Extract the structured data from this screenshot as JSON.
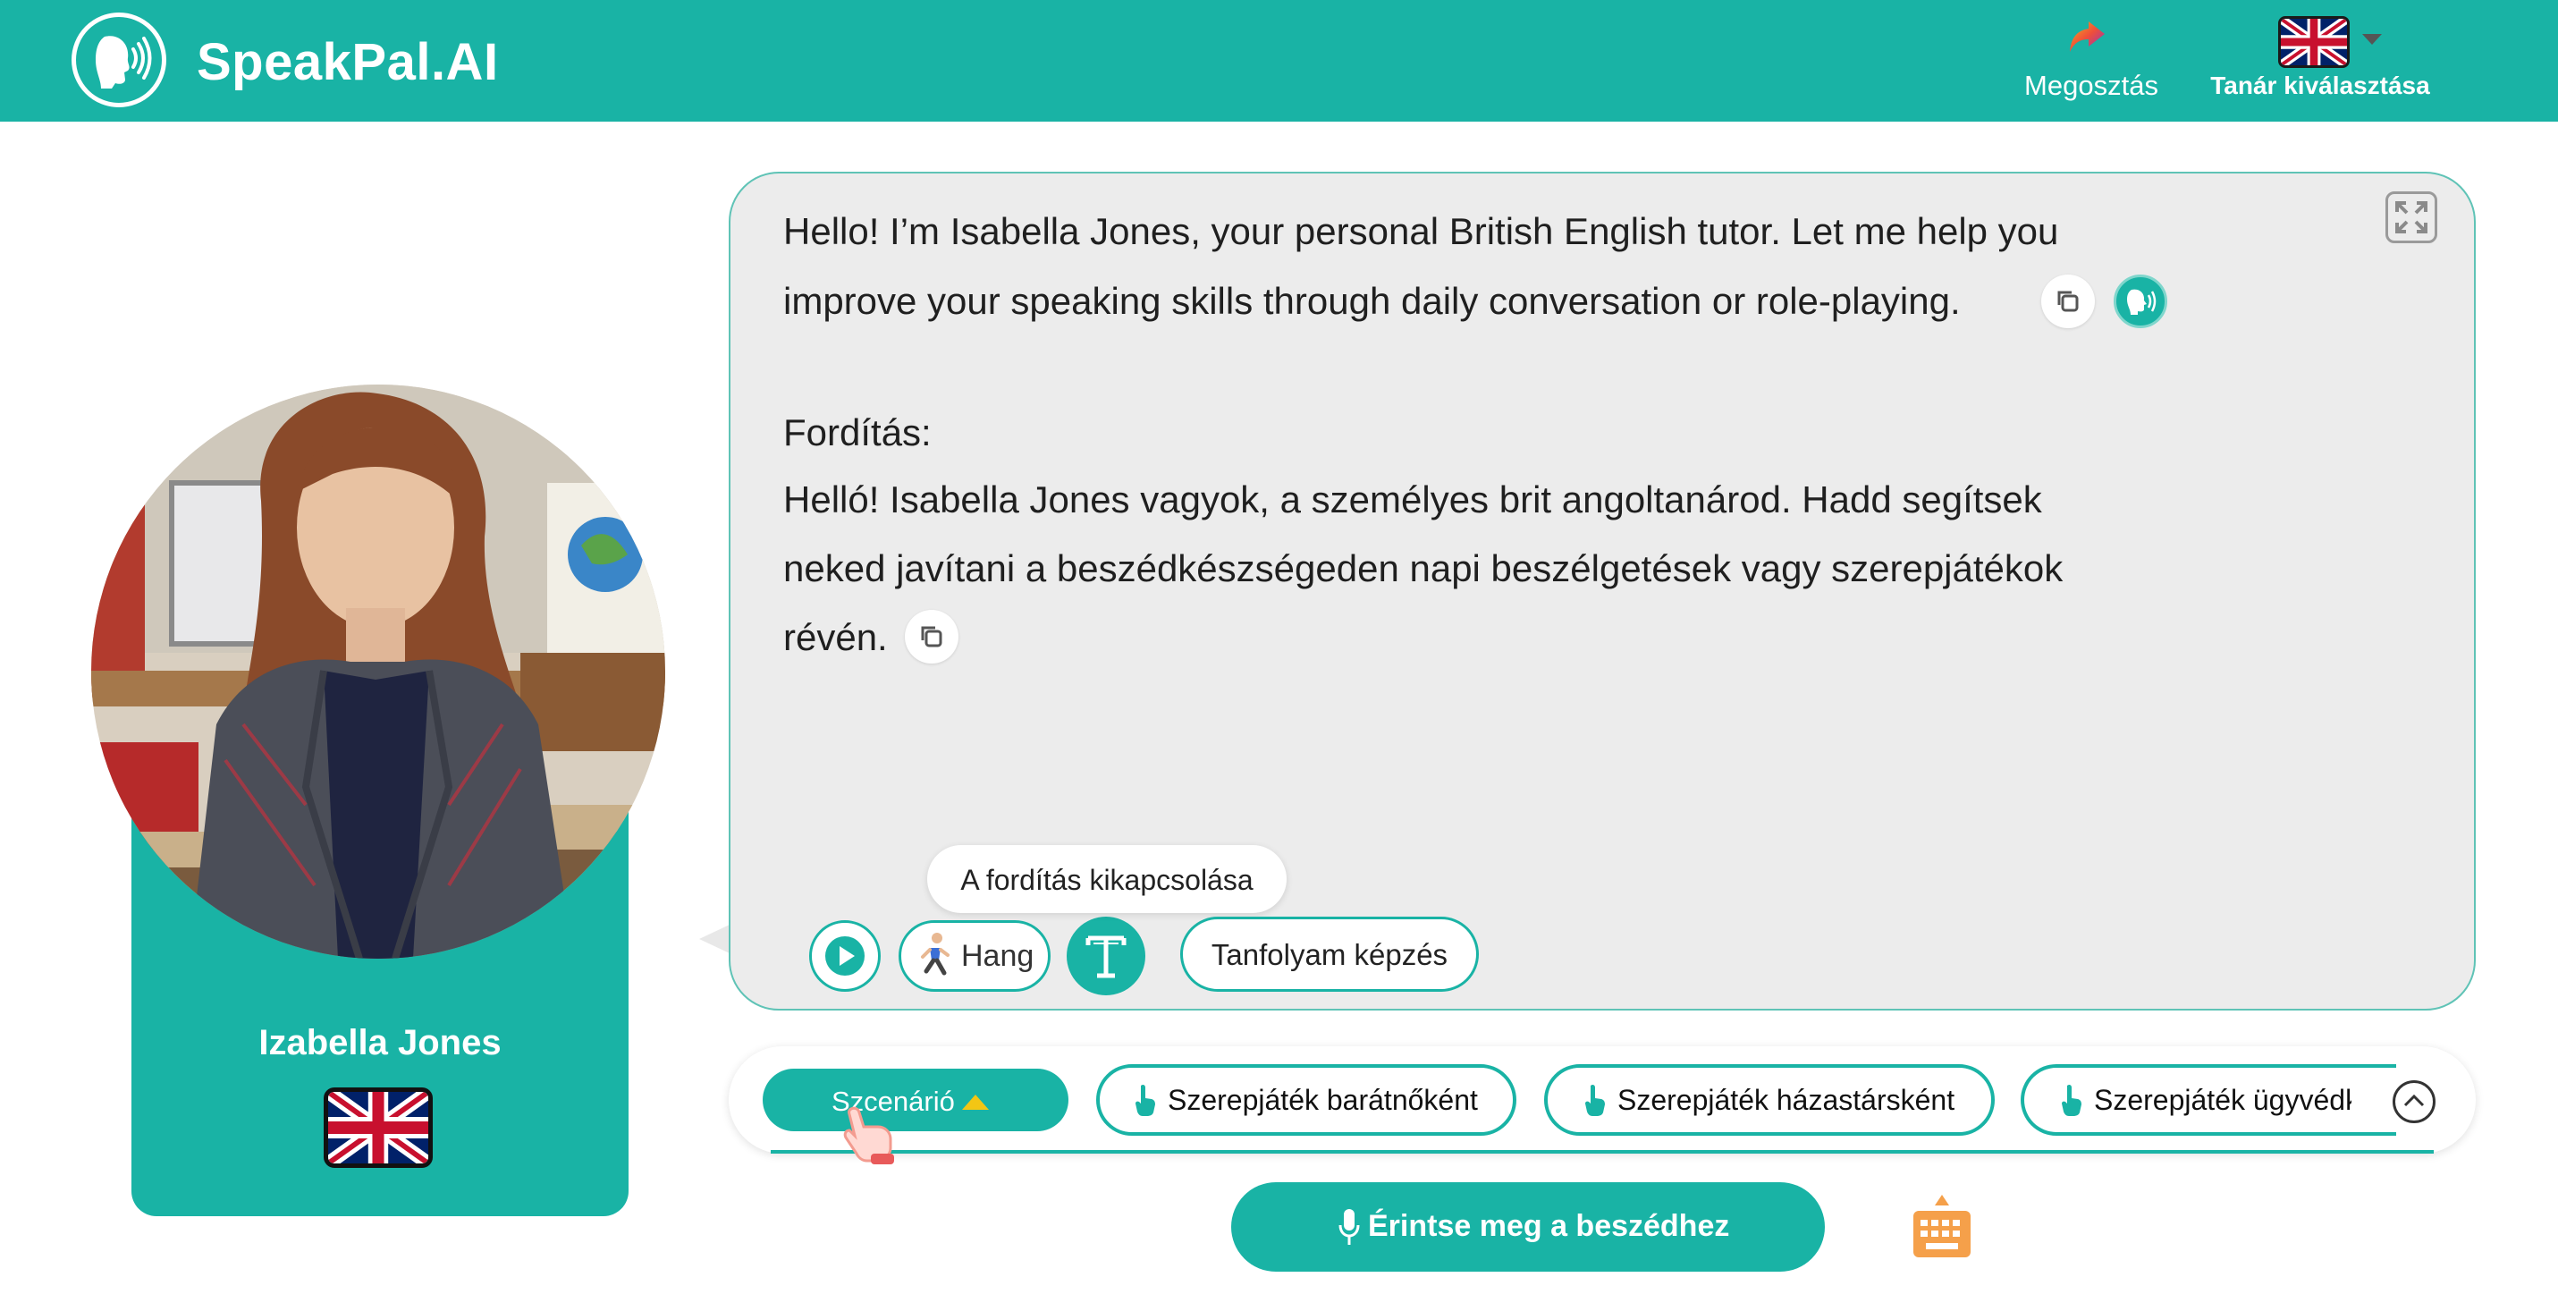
{
  "app": {
    "name": "SpeakPal.AI"
  },
  "header": {
    "share_label": "Megosztás",
    "teacher_select_label": "Tanár kiválasztása",
    "language_flag": "uk-flag-icon"
  },
  "tutor": {
    "name": "Izabella Jones",
    "flag": "uk-flag-icon"
  },
  "message": {
    "original_lines": [
      "Hello! I’m Isabella Jones, your personal British English tutor. Let me help you",
      "improve your speaking skills through daily conversation or role-playing."
    ],
    "translation_heading": "Fordítás:",
    "translation_lines": [
      "Helló! Isabella Jones vagyok, a személyes brit angoltanárod. Hadd segítsek",
      "neked javítani a beszédkészségeden napi beszélgetések vagy szerepjátékok",
      "révén."
    ]
  },
  "controls": {
    "voice_label": "Hang",
    "translate_tooltip": "A fordítás kikapcsolása",
    "course_label": "Tanfolyam képzés"
  },
  "scenario": {
    "button_label": "Szcenárió",
    "chips": [
      "Szerepjáték barátnőként",
      "Szerepjáték házastársként",
      "Szerepjáték ügyvédként"
    ]
  },
  "bottom": {
    "talk_label": "Érintse meg a beszédhez"
  },
  "colors": {
    "accent": "#19b3a5",
    "bubble": "#ececec",
    "warning": "#f3c614",
    "keyboard": "#f5a04a"
  }
}
